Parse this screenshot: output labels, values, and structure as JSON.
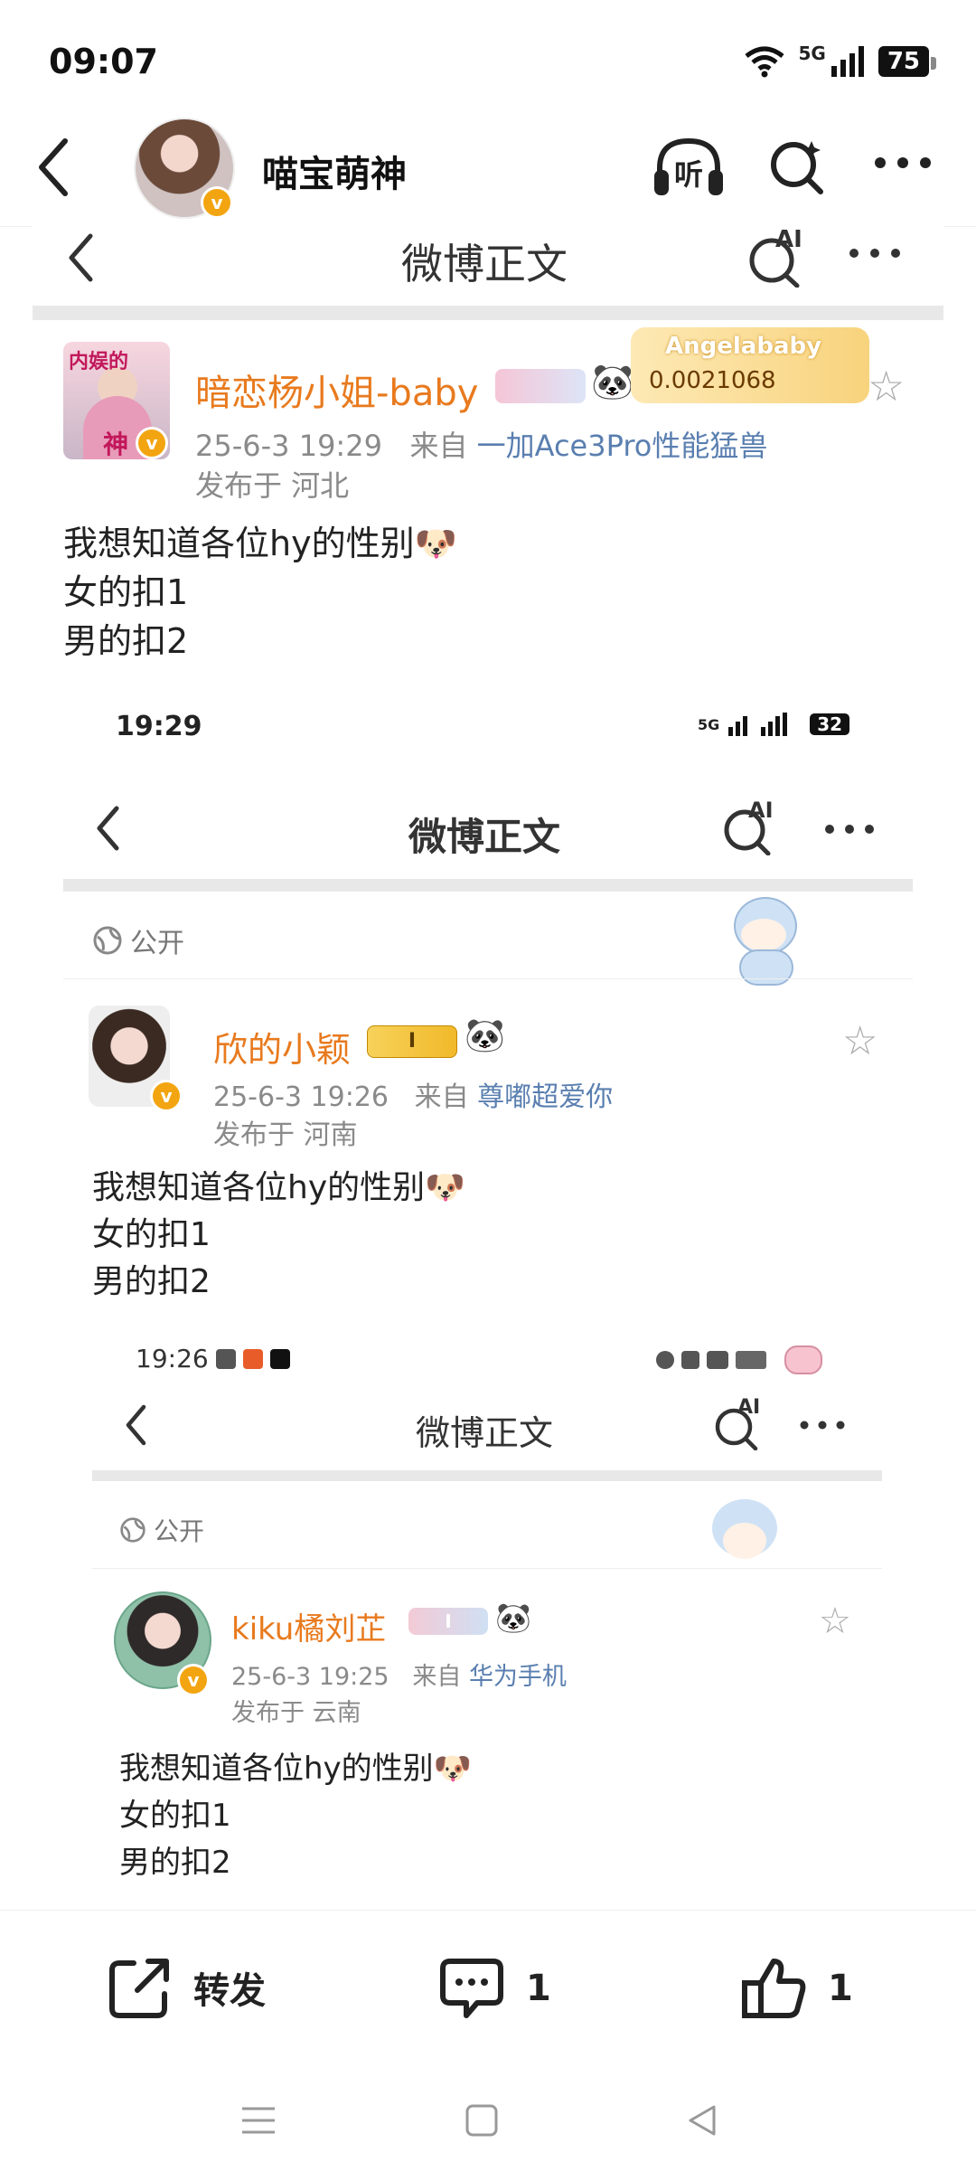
{
  "status_bar": {
    "time": "09:07",
    "network": "5G",
    "battery": "75"
  },
  "top_nav": {
    "title": "喵宝萌神"
  },
  "embedded_post": {
    "header_title": "微博正文",
    "ai_label": "AI",
    "author": {
      "name": "暗恋杨小姐-baby",
      "avatar_text_1": "内娱的",
      "avatar_text_2": "神"
    },
    "fan_badge": {
      "label": "Angelababy",
      "value": "0.0021068"
    },
    "meta": {
      "date": "25-6-3 19:29",
      "from_prefix": "来自",
      "source": "一加Ace3Pro性能猛兽",
      "location": "发布于 河北"
    },
    "lines": [
      "我想知道各位hy的性别",
      "女的扣1",
      "男的扣2"
    ],
    "emoji": "🐶",
    "nested1": {
      "status_time": "19:29",
      "network": "5G",
      "battery": "32",
      "header_title": "微博正文",
      "ai_label": "AI",
      "visibility": "公开",
      "author": {
        "name": "欣的小颖",
        "badge_level": "I"
      },
      "meta": {
        "date": "25-6-3 19:26",
        "from_prefix": "来自",
        "source": "尊嘟超爱你",
        "location": "发布于 河南"
      },
      "lines": [
        "我想知道各位hy的性别",
        "女的扣1",
        "男的扣2"
      ],
      "nested2": {
        "status_time": "19:26",
        "header_title": "微博正文",
        "ai_label": "AI",
        "visibility": "公开",
        "author": {
          "name": "kiku橘刘芷",
          "badge_level": "I"
        },
        "meta": {
          "date": "25-6-3 19:25",
          "from_prefix": "来自",
          "source": "华为手机",
          "location": "发布于 云南"
        },
        "lines": [
          "我想知道各位hy的性别",
          "女的扣1",
          "男的扣2"
        ]
      }
    }
  },
  "bottom_bar": {
    "repost_label": "转发",
    "comment_count": "1",
    "like_count": "1"
  }
}
